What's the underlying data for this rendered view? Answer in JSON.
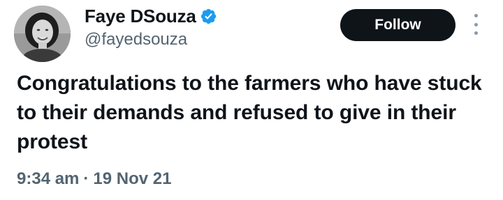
{
  "author": {
    "display_name": "Faye DSouza",
    "handle": "@fayedsouza",
    "verified": true,
    "verified_color": "#1d9bf0"
  },
  "actions": {
    "follow_label": "Follow",
    "more_icon": "more-vertical-icon"
  },
  "tweet": {
    "text": "Congratulations to the farmers who have stuck to their demands and refused to give in their protest",
    "time": "9:34 am",
    "separator": "·",
    "date": "19 Nov 21"
  }
}
